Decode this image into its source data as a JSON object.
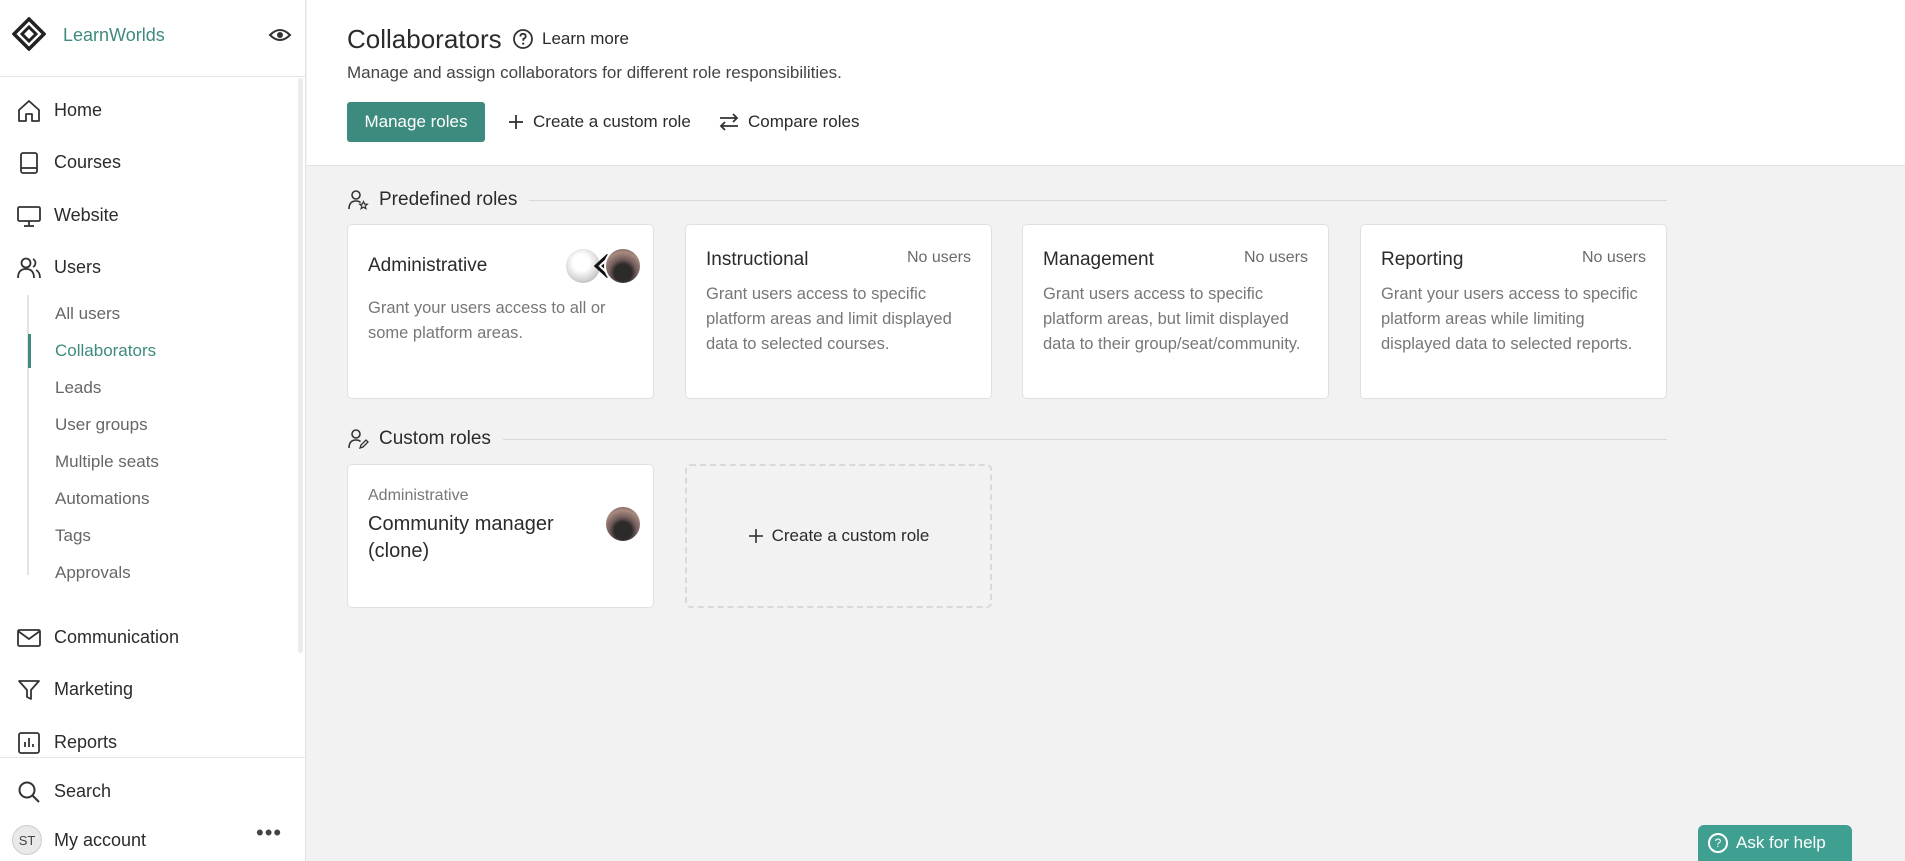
{
  "app": {
    "name": "LearnWorlds"
  },
  "sidebar": {
    "main": [
      {
        "label": "Home",
        "icon": "home-icon"
      },
      {
        "label": "Courses",
        "icon": "book-icon"
      },
      {
        "label": "Website",
        "icon": "monitor-icon"
      },
      {
        "label": "Users",
        "icon": "users-icon"
      }
    ],
    "users_sub": [
      {
        "label": "All users"
      },
      {
        "label": "Collaborators",
        "active": true
      },
      {
        "label": "Leads"
      },
      {
        "label": "User groups"
      },
      {
        "label": "Multiple seats"
      },
      {
        "label": "Automations"
      },
      {
        "label": "Tags"
      },
      {
        "label": "Approvals"
      }
    ],
    "lower": [
      {
        "label": "Communication",
        "icon": "mail-icon"
      },
      {
        "label": "Marketing",
        "icon": "filter-icon"
      },
      {
        "label": "Reports",
        "icon": "chart-icon"
      }
    ],
    "bottom": {
      "search": "Search",
      "account": "My account",
      "avatar_initials": "ST"
    }
  },
  "header": {
    "title": "Collaborators",
    "learn_more": "Learn more",
    "subtitle": "Manage and assign collaborators for different role responsibilities.",
    "manage_roles": "Manage roles",
    "create_custom_role": "Create a custom role",
    "compare_roles": "Compare roles"
  },
  "predefined": {
    "heading": "Predefined roles",
    "roles": [
      {
        "title": "Administrative",
        "count": "",
        "desc": "Grant your users access to all or some platform areas."
      },
      {
        "title": "Instructional",
        "count": "No users",
        "desc": "Grant users access to specific platform areas and limit displayed data to selected courses."
      },
      {
        "title": "Management",
        "count": "No users",
        "desc": "Grant users access to specific platform areas, but limit displayed data to their group/seat/community."
      },
      {
        "title": "Reporting",
        "count": "No users",
        "desc": "Grant your users access to specific platform areas while limiting displayed data to selected reports."
      }
    ]
  },
  "custom": {
    "heading": "Custom roles",
    "roles": [
      {
        "base": "Administrative",
        "title": "Community manager (clone)"
      }
    ],
    "create_label": "Create a custom role"
  },
  "help": {
    "label": "Ask for help"
  },
  "colors": {
    "accent": "#3d8b7e",
    "help": "#3fa092"
  }
}
